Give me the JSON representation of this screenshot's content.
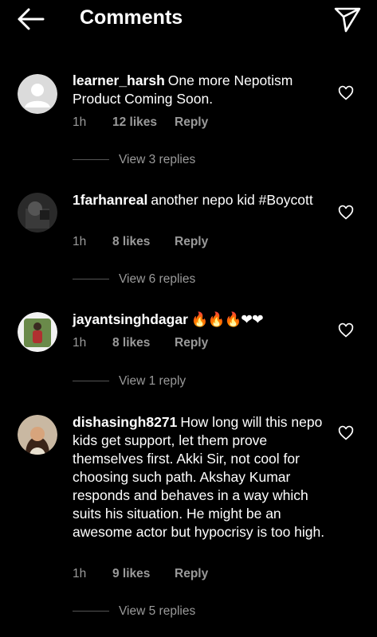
{
  "header": {
    "title": "Comments"
  },
  "comments": [
    {
      "username": "learner_harsh",
      "text": "One more Nepotism Product Coming Soon.",
      "time": "1h",
      "likes": "12 likes",
      "reply": "Reply",
      "view_replies": "View 3 replies"
    },
    {
      "username": "1farhanreal",
      "text": "another nepo kid #Boycott",
      "time": "1h",
      "likes": "8 likes",
      "reply": "Reply",
      "view_replies": "View 6 replies"
    },
    {
      "username": "jayantsinghdagar",
      "text": "🔥🔥🔥❤❤",
      "time": "1h",
      "likes": "8 likes",
      "reply": "Reply",
      "view_replies": "View 1 reply"
    },
    {
      "username": "dishasingh8271",
      "text": "How long will this nepo kids get support, let them prove themselves first. Akki Sir, not cool for choosing such path. Akshay Kumar responds and behaves in a way which suits his situation. He might be an awesome actor but hypocrisy is too high.",
      "time": "1h",
      "likes": "9 likes",
      "reply": "Reply",
      "view_replies": "View 5 replies"
    }
  ]
}
